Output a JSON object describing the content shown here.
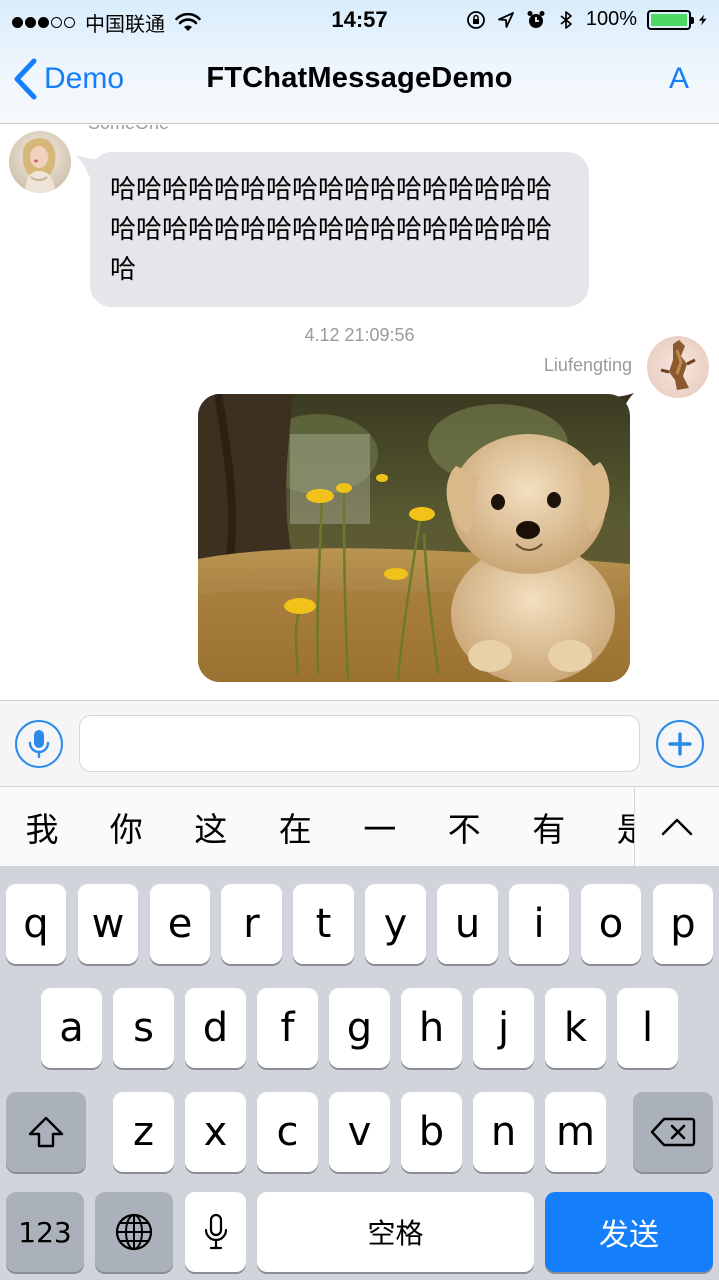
{
  "status_bar": {
    "carrier": "中国联通",
    "time": "14:57",
    "battery_percent": "100%",
    "battery_level": 1.0,
    "signal_bars_filled": 3,
    "signal_bars_total": 5
  },
  "nav": {
    "back_label": "Demo",
    "title": "FTChatMessageDemo",
    "right_label": "A"
  },
  "chat": {
    "messages": [
      {
        "sender": "SomeOne",
        "side": "left",
        "type": "text",
        "text": "哈哈哈哈哈哈哈哈哈哈哈哈哈哈哈哈哈哈哈哈哈哈哈哈哈哈哈哈哈哈哈哈哈哈哈"
      },
      {
        "timestamp": "4.12 21:09:56"
      },
      {
        "sender": "Liufengting",
        "side": "right",
        "type": "image",
        "icon": "puppy-photo"
      }
    ]
  },
  "input_bar": {
    "voice_icon": "microphone-icon",
    "placeholder": "",
    "value": "",
    "plus_icon": "plus-icon"
  },
  "candidates": {
    "items": [
      "我",
      "你",
      "这",
      "在",
      "一",
      "不",
      "有",
      "是"
    ],
    "expand_icon": "chevron-up-icon"
  },
  "keyboard": {
    "row1": [
      "q",
      "w",
      "e",
      "r",
      "t",
      "y",
      "u",
      "i",
      "o",
      "p"
    ],
    "row2": [
      "a",
      "s",
      "d",
      "f",
      "g",
      "h",
      "j",
      "k",
      "l"
    ],
    "row3": [
      "z",
      "x",
      "c",
      "v",
      "b",
      "n",
      "m"
    ],
    "numbers_label": "123",
    "space_label": "空格",
    "send_label": "发送"
  },
  "colors": {
    "accent": "#157efb",
    "bubble_gray": "#e5e5ea",
    "keyboard_bg": "#d1d5db",
    "battery_green": "#4cd964"
  }
}
